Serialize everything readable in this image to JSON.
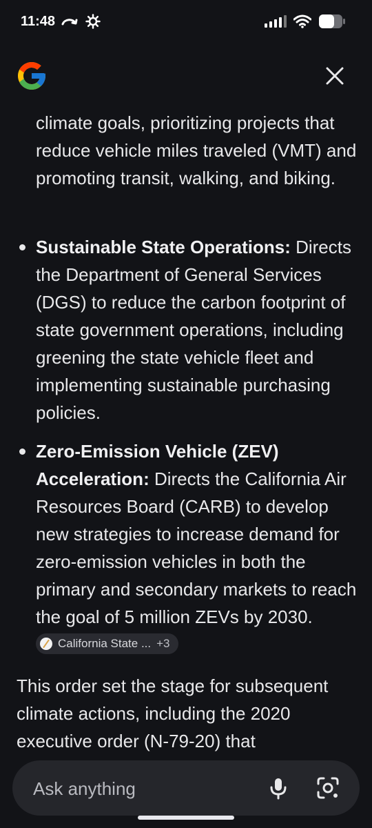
{
  "status_bar": {
    "time": "11:48",
    "icons": [
      "call-forward-icon",
      "settings-gear-icon",
      "signal-icon",
      "wifi-icon",
      "battery-icon"
    ]
  },
  "header": {
    "logo": "google-g-logo",
    "close_icon": "close-icon"
  },
  "content": {
    "para_continued": "climate goals, prioritizing projects that reduce vehicle miles traveled (VMT) and promoting transit, walking, and biking.",
    "bullets": [
      {
        "title": "Sustainable State Operations:",
        "text": " Directs the Department of General Services (DGS) to reduce the carbon footprint of state government operations, including greening the state vehicle fleet and implementing sustainable purchasing policies."
      },
      {
        "title": "Zero-Emission Vehicle (ZEV) Acceleration:",
        "text": " Directs the California Air Resources Board (CARB) to develop new strategies to increase demand for zero-emission vehicles in both the primary and secondary markets to reach the goal of 5 million ZEVs by 2030.",
        "source_chip": {
          "label": "California State ...",
          "count": "+3"
        }
      }
    ],
    "final_para": "This order set the stage for subsequent climate actions, including the 2020 executive order (N-79-20) that"
  },
  "ask_bar": {
    "placeholder": "Ask anything",
    "mic_icon": "microphone-icon",
    "lens_icon": "camera-lens-icon"
  },
  "colors": {
    "background": "#121317",
    "text": "#e8e8ea",
    "chip_bg": "#2a2b31",
    "input_bg": "#25262b"
  }
}
